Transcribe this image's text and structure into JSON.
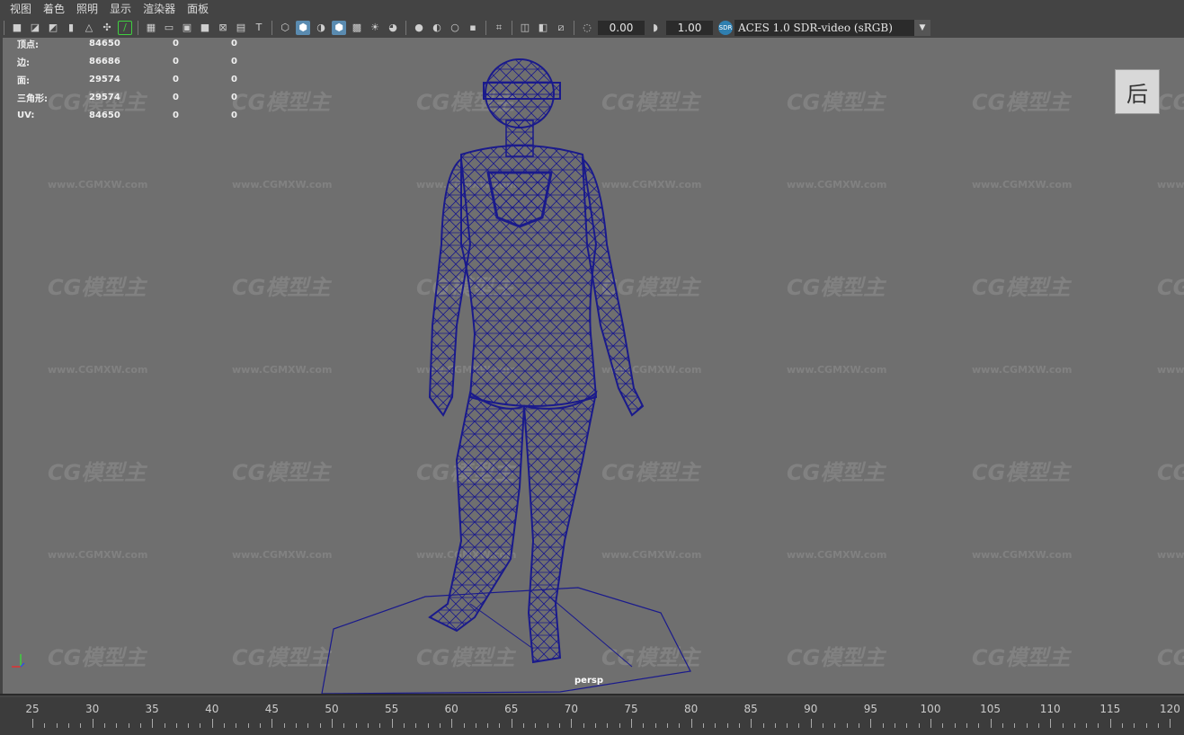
{
  "menu": [
    "视图",
    "着色",
    "照明",
    "显示",
    "渲染器",
    "面板"
  ],
  "toolbar": {
    "exposure": "0.00",
    "gamma": "1.00",
    "color_space": "ACES 1.0 SDR-video (sRGB)",
    "colorspace_icon": "SDR"
  },
  "hud": {
    "rows": [
      {
        "label": "顶点:",
        "v1": "84650",
        "v2": "0",
        "v3": "0"
      },
      {
        "label": "边:",
        "v1": "86686",
        "v2": "0",
        "v3": "0"
      },
      {
        "label": "面:",
        "v1": "29574",
        "v2": "0",
        "v3": "0"
      },
      {
        "label": "三角形:",
        "v1": "29574",
        "v2": "0",
        "v3": "0"
      },
      {
        "label": "UV:",
        "v1": "84650",
        "v2": "0",
        "v3": "0"
      }
    ]
  },
  "viewcube_label": "后",
  "camera_label": "persp",
  "axis": {
    "y": "Y",
    "x": "X",
    "z": "Z"
  },
  "watermark": {
    "logo": "CG模型主",
    "url": "www.CGMXW.com"
  },
  "timeline": {
    "labels": [
      "25",
      "30",
      "35",
      "40",
      "45",
      "50",
      "55",
      "60",
      "65",
      "70",
      "75",
      "80",
      "85",
      "90",
      "95",
      "100",
      "105",
      "110",
      "115",
      "120"
    ]
  },
  "colors": {
    "wireframe": "#1a1a8c",
    "viewport_bg": "#6f6f6f",
    "highlight": "#5a8bb0"
  }
}
